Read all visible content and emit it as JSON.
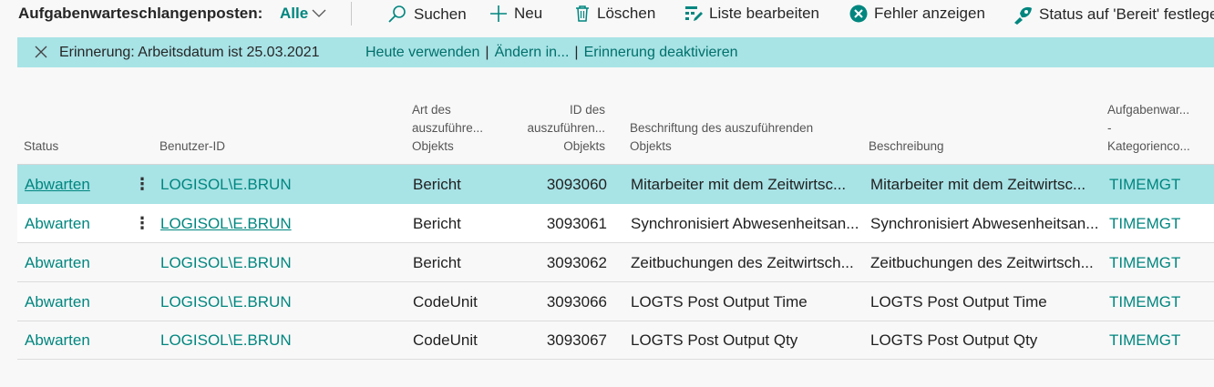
{
  "toolbar": {
    "title": "Aufgabenwarteschlangenposten:",
    "filter": "Alle",
    "actions": {
      "search": "Suchen",
      "new": "Neu",
      "delete": "Löschen",
      "edit_list": "Liste bearbeiten",
      "show_error": "Fehler anzeigen",
      "set_ready": "Status auf 'Bereit' festlege"
    }
  },
  "banner": {
    "message": "Erinnerung: Arbeitsdatum ist 25.03.2021",
    "use_today": "Heute verwenden",
    "change": "Ändern in...",
    "disable": "Erinnerung deaktivieren"
  },
  "columns": {
    "status": [
      "Status"
    ],
    "user": [
      "Benutzer-ID"
    ],
    "obj_type": [
      "Art des",
      "auszuführe...",
      "Objekts"
    ],
    "obj_id": [
      "ID des",
      "auszuführen...",
      "Objekts"
    ],
    "obj_caption": [
      "Beschriftung des auszuführenden",
      "Objekts"
    ],
    "description": [
      "Beschreibung"
    ],
    "category": [
      "Aufgabenwar...",
      "-",
      "Kategorienco..."
    ]
  },
  "rows": [
    {
      "status": "Abwarten",
      "user": "LOGISOL\\E.BRUN",
      "obj_type": "Bericht",
      "obj_id": "3093060",
      "caption": "Mitarbeiter mit dem Zeitwirtsc...",
      "description": "Mitarbeiter mit dem Zeitwirtsc...",
      "category": "TIMEMGT"
    },
    {
      "status": "Abwarten",
      "user": "LOGISOL\\E.BRUN",
      "obj_type": "Bericht",
      "obj_id": "3093061",
      "caption": "Synchronisiert Abwesenheitsan...",
      "description": "Synchronisiert Abwesenheitsan...",
      "category": "TIMEMGT"
    },
    {
      "status": "Abwarten",
      "user": "LOGISOL\\E.BRUN",
      "obj_type": "Bericht",
      "obj_id": "3093062",
      "caption": "Zeitbuchungen des Zeitwirtsch...",
      "description": "Zeitbuchungen des Zeitwirtsch...",
      "category": "TIMEMGT"
    },
    {
      "status": "Abwarten",
      "user": "LOGISOL\\E.BRUN",
      "obj_type": "CodeUnit",
      "obj_id": "3093066",
      "caption": "LOGTS Post Output Time",
      "description": "LOGTS Post Output Time",
      "category": "TIMEMGT"
    },
    {
      "status": "Abwarten",
      "user": "LOGISOL\\E.BRUN",
      "obj_type": "CodeUnit",
      "obj_id": "3093067",
      "caption": "LOGTS Post Output Qty",
      "description": "LOGTS Post Output Qty",
      "category": "TIMEMGT"
    }
  ],
  "colors": {
    "accent": "#00867f",
    "selection": "#a8e3e6"
  }
}
